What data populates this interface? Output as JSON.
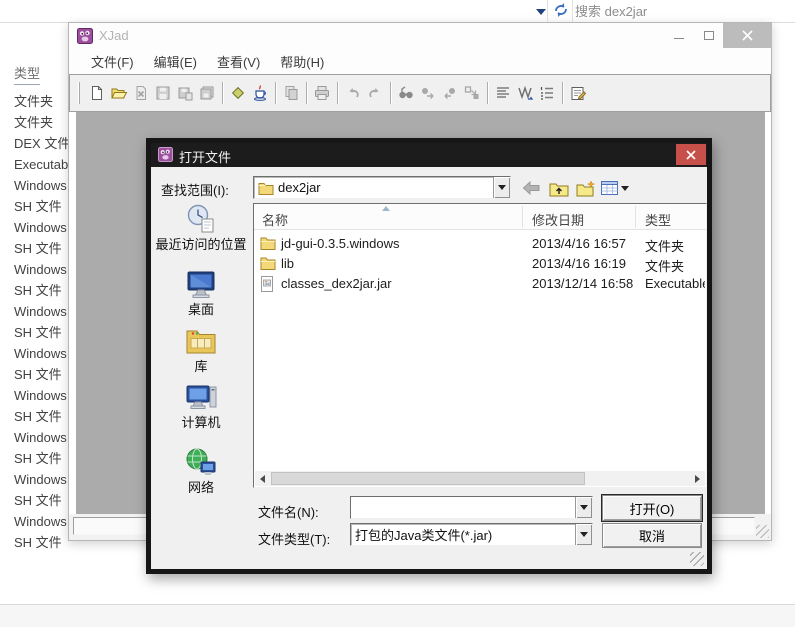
{
  "colors": {
    "dialog_titlebar": "#1c1c1c",
    "dialog_close_button": "#c7504b",
    "xjad_inactive_close": "#bcbcbc",
    "content_gray": "#ababab",
    "folder_yellow": "#f3d977",
    "accent_blue": "#3a6fc0"
  },
  "explorer": {
    "topbar": {
      "search_placeholder": "搜索 dex2jar",
      "icons": [
        "address-dropdown-icon",
        "refresh-icon"
      ]
    },
    "type_column": {
      "header": "类型",
      "cells": [
        "文件夹",
        "文件夹",
        "DEX 文件",
        "Executable",
        "Windows",
        "SH 文件",
        "Windows",
        "SH 文件",
        "Windows",
        "SH 文件",
        "Windows",
        "SH 文件",
        "Windows",
        "SH 文件",
        "Windows",
        "SH 文件",
        "Windows",
        "SH 文件",
        "Windows",
        "SH 文件",
        "Windows",
        "SH 文件"
      ]
    }
  },
  "xjad": {
    "window_title": "XJad",
    "menu": [
      "文件(F)",
      "编辑(E)",
      "查看(V)",
      "帮助(H)"
    ],
    "toolbar_icons": [
      "new-file-icon",
      "open-file-icon",
      "close-file-icon",
      "save-icon",
      "save-as-icon",
      "save-all-icon",
      "decompile-icon",
      "java-icon",
      "copy-icon",
      "print-icon",
      "undo-icon",
      "redo-icon",
      "find-icon",
      "find-next-icon",
      "find-prev-icon",
      "replace-icon",
      "align-icon",
      "word-wrap-icon",
      "line-numbers-icon",
      "properties-icon"
    ]
  },
  "dialog": {
    "title": "打开文件",
    "lookin": {
      "label": "查找范围(I):",
      "value": "dex2jar"
    },
    "toolbar_icons": [
      "back-icon",
      "up-one-level-icon",
      "new-folder-icon",
      "view-menu-icon"
    ],
    "places": [
      {
        "label": "最近访问的位置",
        "icon": "recent-places-icon"
      },
      {
        "label": "桌面",
        "icon": "desktop-icon"
      },
      {
        "label": "库",
        "icon": "libraries-icon"
      },
      {
        "label": "计算机",
        "icon": "computer-icon"
      },
      {
        "label": "网络",
        "icon": "network-icon"
      }
    ],
    "list": {
      "columns": [
        "名称",
        "修改日期",
        "类型"
      ],
      "rows": [
        {
          "name": "jd-gui-0.3.5.windows",
          "date": "2013/4/16 16:57",
          "type": "文件夹",
          "icon": "folder-icon"
        },
        {
          "name": "lib",
          "date": "2013/4/16 16:19",
          "type": "文件夹",
          "icon": "folder-icon"
        },
        {
          "name": "classes_dex2jar.jar",
          "date": "2013/12/14 16:58",
          "type": "Executable",
          "icon": "jar-file-icon"
        }
      ]
    },
    "filename": {
      "label": "文件名(N):",
      "value": ""
    },
    "filetype": {
      "label": "文件类型(T):",
      "value": "打包的Java类文件(*.jar)"
    },
    "buttons": {
      "open": "打开(O)",
      "cancel": "取消"
    }
  }
}
